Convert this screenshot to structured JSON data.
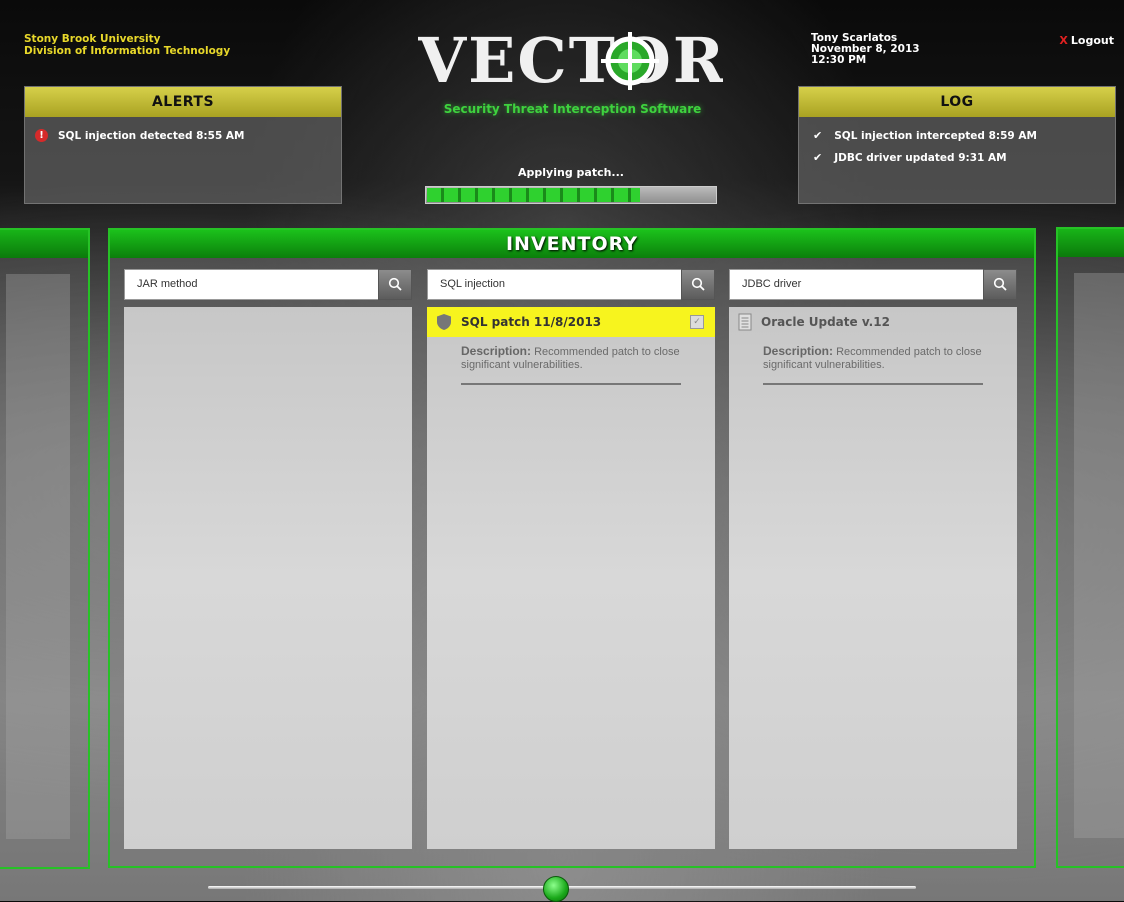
{
  "header": {
    "org_line1": "Stony Brook University",
    "org_line2": "Division of Information Technology",
    "app_name": "VECTOR",
    "tagline": "Security Threat Interception Software",
    "user_name": "Tony Scarlatos",
    "date": "November 8, 2013",
    "time": "12:30 PM",
    "logout_x": "X",
    "logout_label": "Logout"
  },
  "alerts": {
    "title": "ALERTS",
    "items": [
      {
        "icon": "alert-icon",
        "text": "SQL injection detected 8:55 AM"
      }
    ]
  },
  "log": {
    "title": "LOG",
    "items": [
      {
        "icon": "check-icon",
        "text": "SQL injection intercepted 8:59 AM"
      },
      {
        "icon": "check-icon",
        "text": "JDBC driver updated 9:31 AM"
      }
    ]
  },
  "patch": {
    "label": "Applying patch...",
    "progress": 0.74
  },
  "inventory": {
    "title": "INVENTORY",
    "columns": [
      {
        "search_value": "JAR method",
        "items": []
      },
      {
        "search_value": "SQL injection",
        "items": [
          {
            "icon": "shield-icon",
            "title": "SQL patch 11/8/2013",
            "desc_label": "Description:",
            "desc_text": " Recommended patch to close significant vulnerabilities.",
            "selected": true
          }
        ]
      },
      {
        "search_value": "JDBC driver",
        "items": [
          {
            "icon": "document-icon",
            "title": "Oracle Update v.12",
            "desc_label": "Description:",
            "desc_text": " Recommended patch to close significant vulnerabilities.",
            "selected": false
          }
        ]
      }
    ]
  },
  "carousel": {
    "position": 0.49
  },
  "colors": {
    "accent_green": "#26c226",
    "header_yellow": "#d6d04a",
    "selected_yellow": "#f7f41e",
    "alert_red": "#d62a2a"
  }
}
